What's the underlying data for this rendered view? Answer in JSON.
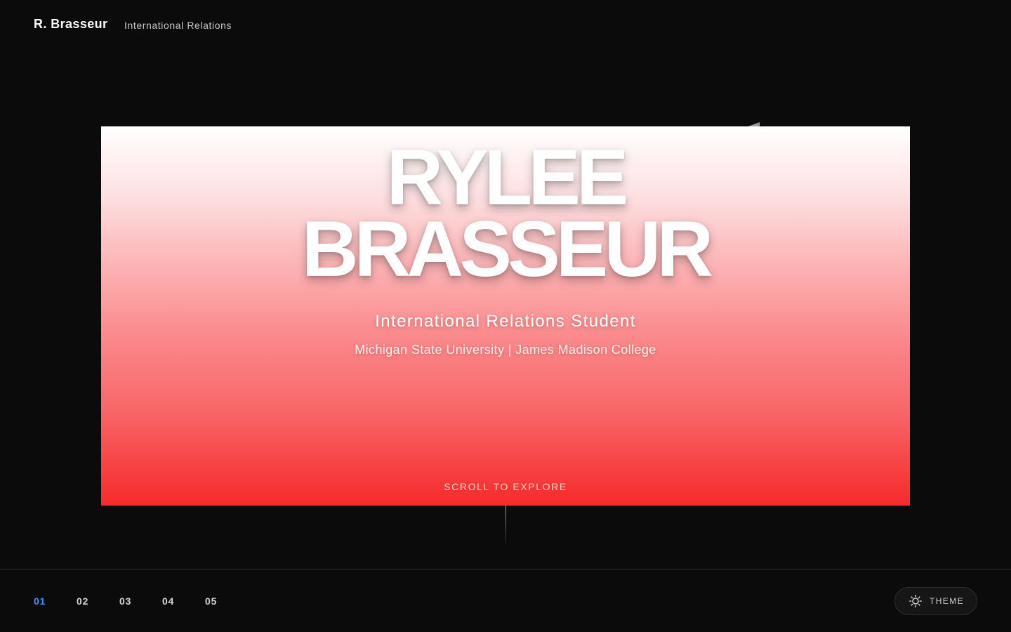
{
  "header": {
    "brand": "R. Brasseur",
    "subtitle": "International Relations"
  },
  "hero": {
    "title_line1": "RYLEE",
    "title_line2": "BRASSEUR",
    "role": "International Relations Student",
    "school": "Michigan State University | James Madison College",
    "scroll_hint": "SCROLL TO EXPLORE"
  },
  "footer": {
    "nav": [
      "01",
      "02",
      "03",
      "04",
      "05"
    ],
    "active_index": 0,
    "theme_label": "THEME",
    "theme_icon": "sun-icon"
  },
  "colors": {
    "background": "#0b0b0b",
    "accent": "#4a8cff",
    "gradient_top": "#ffffff",
    "gradient_bottom": "#f62a2a"
  }
}
